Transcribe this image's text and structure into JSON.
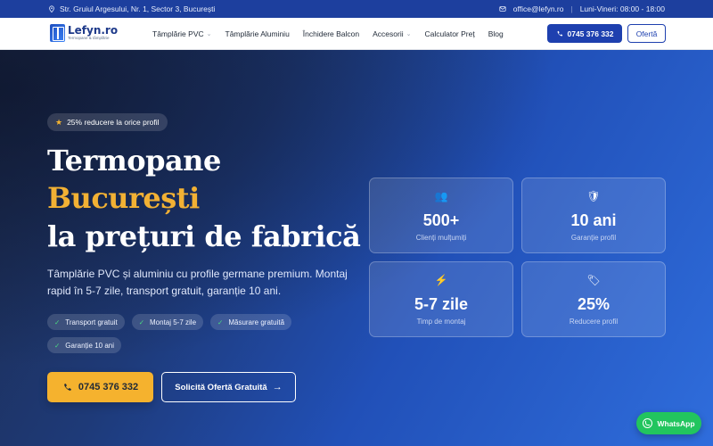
{
  "topbar": {
    "address": "Str. Gruiul Argesului, Nr. 1, Sector 3, București",
    "email": "office@lefyn.ro",
    "hours": "Luni-Vineri: 08:00 - 18:00"
  },
  "logo": {
    "name": "Lefyn.ro",
    "tagline": "Termopane & tâmplărie"
  },
  "menu": [
    {
      "label": "Tâmplărie PVC",
      "dropdown": true
    },
    {
      "label": "Tâmplărie Aluminiu",
      "dropdown": false
    },
    {
      "label": "Închidere Balcon",
      "dropdown": false
    },
    {
      "label": "Accesorii",
      "dropdown": true
    },
    {
      "label": "Calculator Preț",
      "dropdown": false
    },
    {
      "label": "Blog",
      "dropdown": false
    }
  ],
  "nav_phone": "0745 376 332",
  "nav_offer": "Ofertă",
  "hero": {
    "promo": "25% reducere la orice profil",
    "title_line1": "Termopane",
    "title_line2": "București",
    "title_line3": "la prețuri de fabrică",
    "lead": "Tâmplărie PVC și aluminiu cu profile germane premium. Montaj rapid în 5-7 zile, transport gratuit, garanție 10 ani.",
    "chips": [
      "Transport gratuit",
      "Montaj 5-7 zile",
      "Măsurare gratuită",
      "Garanție 10 ani"
    ],
    "cta_phone": "0745 376 332",
    "cta_offer": "Solicită Ofertă Gratuită"
  },
  "stats": [
    {
      "icon": "people-icon",
      "value": "500+",
      "label": "Clienți mulțumiți"
    },
    {
      "icon": "shield-icon",
      "value": "10 ani",
      "label": "Garanție profil"
    },
    {
      "icon": "lightning-icon",
      "value": "5-7 zile",
      "label": "Timp de montaj"
    },
    {
      "icon": "tag-icon",
      "value": "25%",
      "label": "Reducere profil"
    }
  ],
  "whatsapp": "WhatsApp",
  "colors": {
    "primary": "#1e40af",
    "accent": "#f5b22e",
    "whatsapp": "#22c55e"
  }
}
